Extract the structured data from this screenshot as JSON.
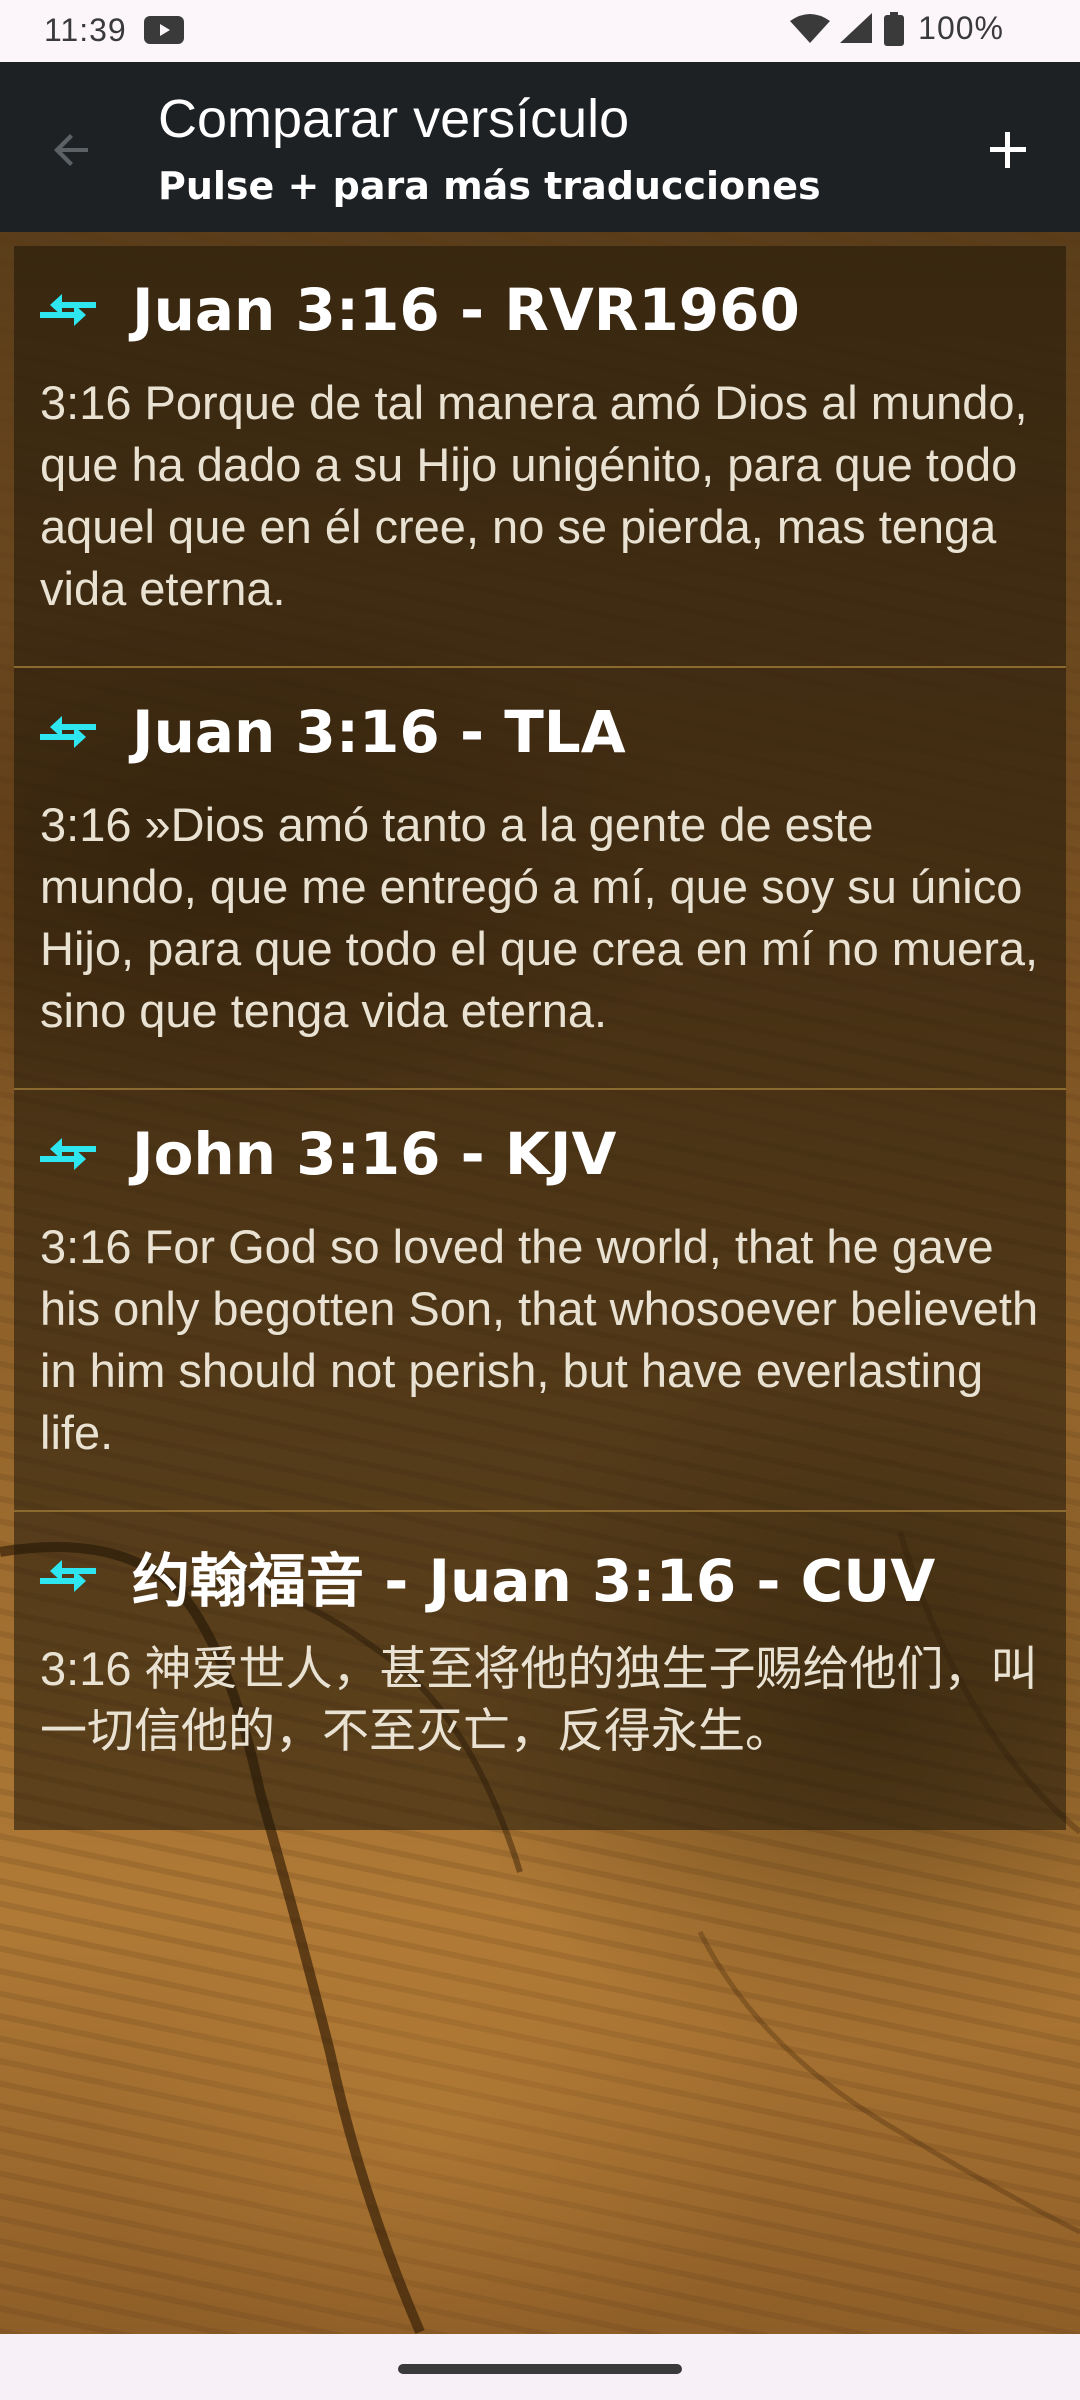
{
  "status_bar": {
    "time": "11:39",
    "battery": "100%"
  },
  "app_bar": {
    "title": "Comparar versículo",
    "subtitle": "Pulse + para más traducciones"
  },
  "verses": [
    {
      "reference": "Juan 3:16 - RVR1960",
      "text": "3:16 Porque de tal manera amó Dios al mundo, que ha dado a su Hijo unigénito, para que todo aquel que en él cree, no se pierda, mas tenga vida eterna."
    },
    {
      "reference": "Juan 3:16 - TLA",
      "text": "3:16 »Dios amó tanto a la gente de este mundo, que me entregó a mí, que soy su único Hijo, para que todo el que crea en mí no muera, sino que tenga vida eterna."
    },
    {
      "reference": "John 3:16 - KJV",
      "text": "3:16 For God so loved the world, that he gave his only begotten Son, that whosoever believeth in him should not perish, but have everlasting life."
    },
    {
      "reference": "约翰福音 - Juan 3:16 - CUV",
      "text": "3:16 神爱世人，甚至将他的独生子赐给他们，叫一切信他的，不至灭亡，反得永生。"
    }
  ],
  "colors": {
    "app_bar_bg": "#1e2124",
    "accent_icon": "#2ee6f0"
  },
  "icons": {
    "back": "arrow-left-icon",
    "add": "plus-icon",
    "compare": "compare-arrows-icon"
  }
}
